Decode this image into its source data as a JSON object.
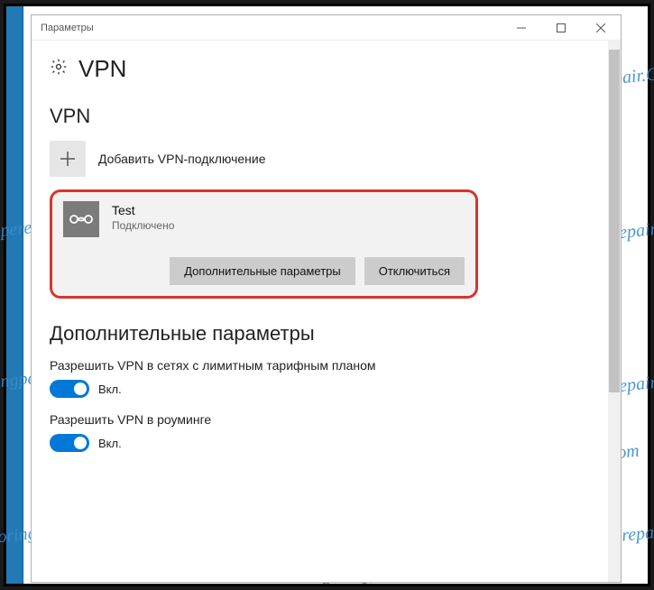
{
  "watermark_text": "Soringperepair.Com",
  "window": {
    "title": "Параметры"
  },
  "header": {
    "page_title": "VPN"
  },
  "vpn_section": {
    "heading": "VPN",
    "add_label": "Добавить VPN-подключение",
    "connection": {
      "name": "Test",
      "status": "Подключено",
      "btn_advanced": "Дополнительные параметры",
      "btn_disconnect": "Отключиться"
    }
  },
  "advanced_section": {
    "heading": "Дополнительные параметры",
    "settings": [
      {
        "label": "Разрешить VPN в сетях с лимитным тарифным планом",
        "state": "Вкл."
      },
      {
        "label": "Разрешить VPN в роуминге",
        "state": "Вкл."
      }
    ]
  }
}
